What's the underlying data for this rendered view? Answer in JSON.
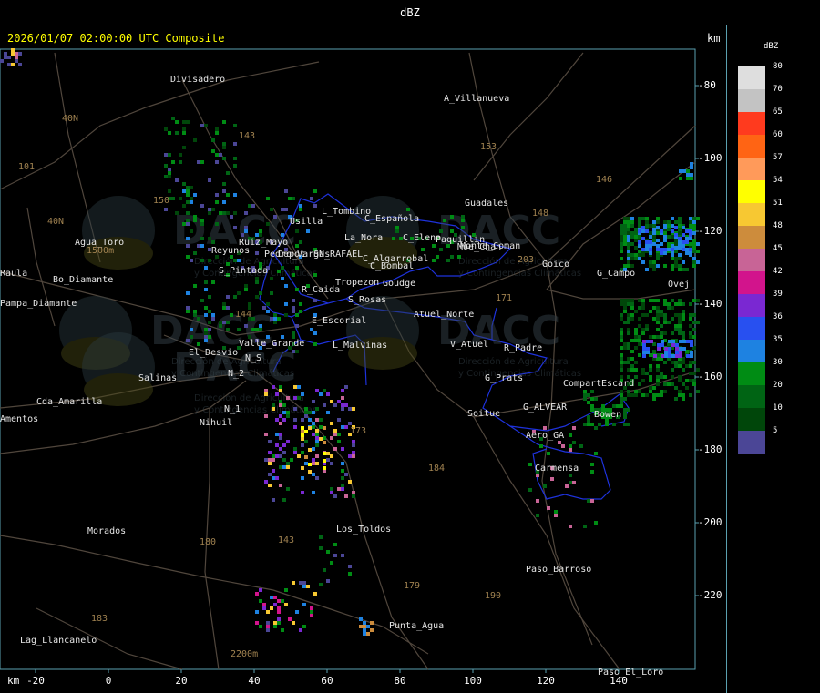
{
  "window": {
    "title": "dBZ"
  },
  "map": {
    "header": "2026/01/07 02:00:00 UTC Composite",
    "unit": "km",
    "x_ticks": [
      {
        "label": "-20",
        "v": -20
      },
      {
        "label": "0",
        "v": 0
      },
      {
        "label": "20",
        "v": 20
      },
      {
        "label": "40",
        "v": 40
      },
      {
        "label": "60",
        "v": 60
      },
      {
        "label": "80",
        "v": 80
      },
      {
        "label": "100",
        "v": 100
      },
      {
        "label": "120",
        "v": 120
      },
      {
        "label": "140",
        "v": 140
      }
    ],
    "y_ticks": [
      {
        "label": "-80",
        "v": -80
      },
      {
        "label": "-100",
        "v": -100
      },
      {
        "label": "-120",
        "v": -120
      },
      {
        "label": "-140",
        "v": -140
      },
      {
        "label": "-160",
        "v": -160
      },
      {
        "label": "-180",
        "v": -180
      },
      {
        "label": "-200",
        "v": -200
      },
      {
        "label": "-220",
        "v": -220
      }
    ],
    "places": [
      "Divisadero",
      "A_Villanueva",
      "Guadales",
      "Goico",
      "G_Campo",
      "Ovej",
      "Usilla",
      "L_Tombino",
      "C_Española",
      "C_Elena",
      "Paquillin",
      "Moe_Chan",
      "La_Nora",
      "C_Bombal",
      "C_Algarrobal",
      "Ruiz_Mayo",
      "Reyunos",
      "Depot",
      "SN_RAFAEL",
      "Pedro_Vargas",
      "S_Pintada",
      "R_Caida",
      "Tropezon",
      "Goudge",
      "S_Rosas",
      "Atuel_Norte",
      "E_Escorial",
      "L_Malvinas",
      "Valle_Grande",
      "El_Desvio",
      "V_Atuel",
      "R_Padre",
      "G_Prats",
      "Compart",
      "Escard",
      "Salinas",
      "N_2",
      "N_S",
      "N_1",
      "Nihuil",
      "G_ALVEAR",
      "Soitue",
      "Aero_GA",
      "Bowen",
      "Carmensa",
      "Cda_Amarilla",
      "Amentos",
      "Morados",
      "Los_Toldos",
      "Paso_Barroso",
      "Punta_Agua",
      "Paso_El_Loro",
      "Lag_Llancanelo",
      "Agua_Toro",
      "Bo_Diamante",
      "Pampa_Diamante",
      "Raula",
      "Monte_Coman"
    ],
    "route_numbers": [
      "143",
      "153",
      "146",
      "148",
      "203",
      "171",
      "101",
      "40N",
      "150",
      "144",
      "173",
      "184",
      "180",
      "179",
      "190",
      "183",
      "40N",
      "143"
    ],
    "watermark": {
      "logo_text": "DACC",
      "line1": "Dirección de Agricultura",
      "line2": "y Contingencias Climáticas"
    },
    "contour_labels": [
      "1500m",
      "2200m"
    ]
  },
  "legend": {
    "unit": "dBZ",
    "scale": [
      {
        "value": "80",
        "color": "#dedede"
      },
      {
        "value": "70",
        "color": "#c3c3c3"
      },
      {
        "value": "65",
        "color": "#ff3a1e"
      },
      {
        "value": "60",
        "color": "#ff6414"
      },
      {
        "value": "57",
        "color": "#ff9a5a"
      },
      {
        "value": "54",
        "color": "#ffff00"
      },
      {
        "value": "51",
        "color": "#f7c832"
      },
      {
        "value": "48",
        "color": "#cd8c3c"
      },
      {
        "value": "45",
        "color": "#c86496"
      },
      {
        "value": "42",
        "color": "#d2148c"
      },
      {
        "value": "39",
        "color": "#7a28d2"
      },
      {
        "value": "36",
        "color": "#2850f0"
      },
      {
        "value": "35",
        "color": "#1e82e1"
      },
      {
        "value": "30",
        "color": "#008c14"
      },
      {
        "value": "20",
        "color": "#006414"
      },
      {
        "value": "10",
        "color": "#00460a"
      },
      {
        "value": "5",
        "color": "#4b4696"
      }
    ]
  }
}
